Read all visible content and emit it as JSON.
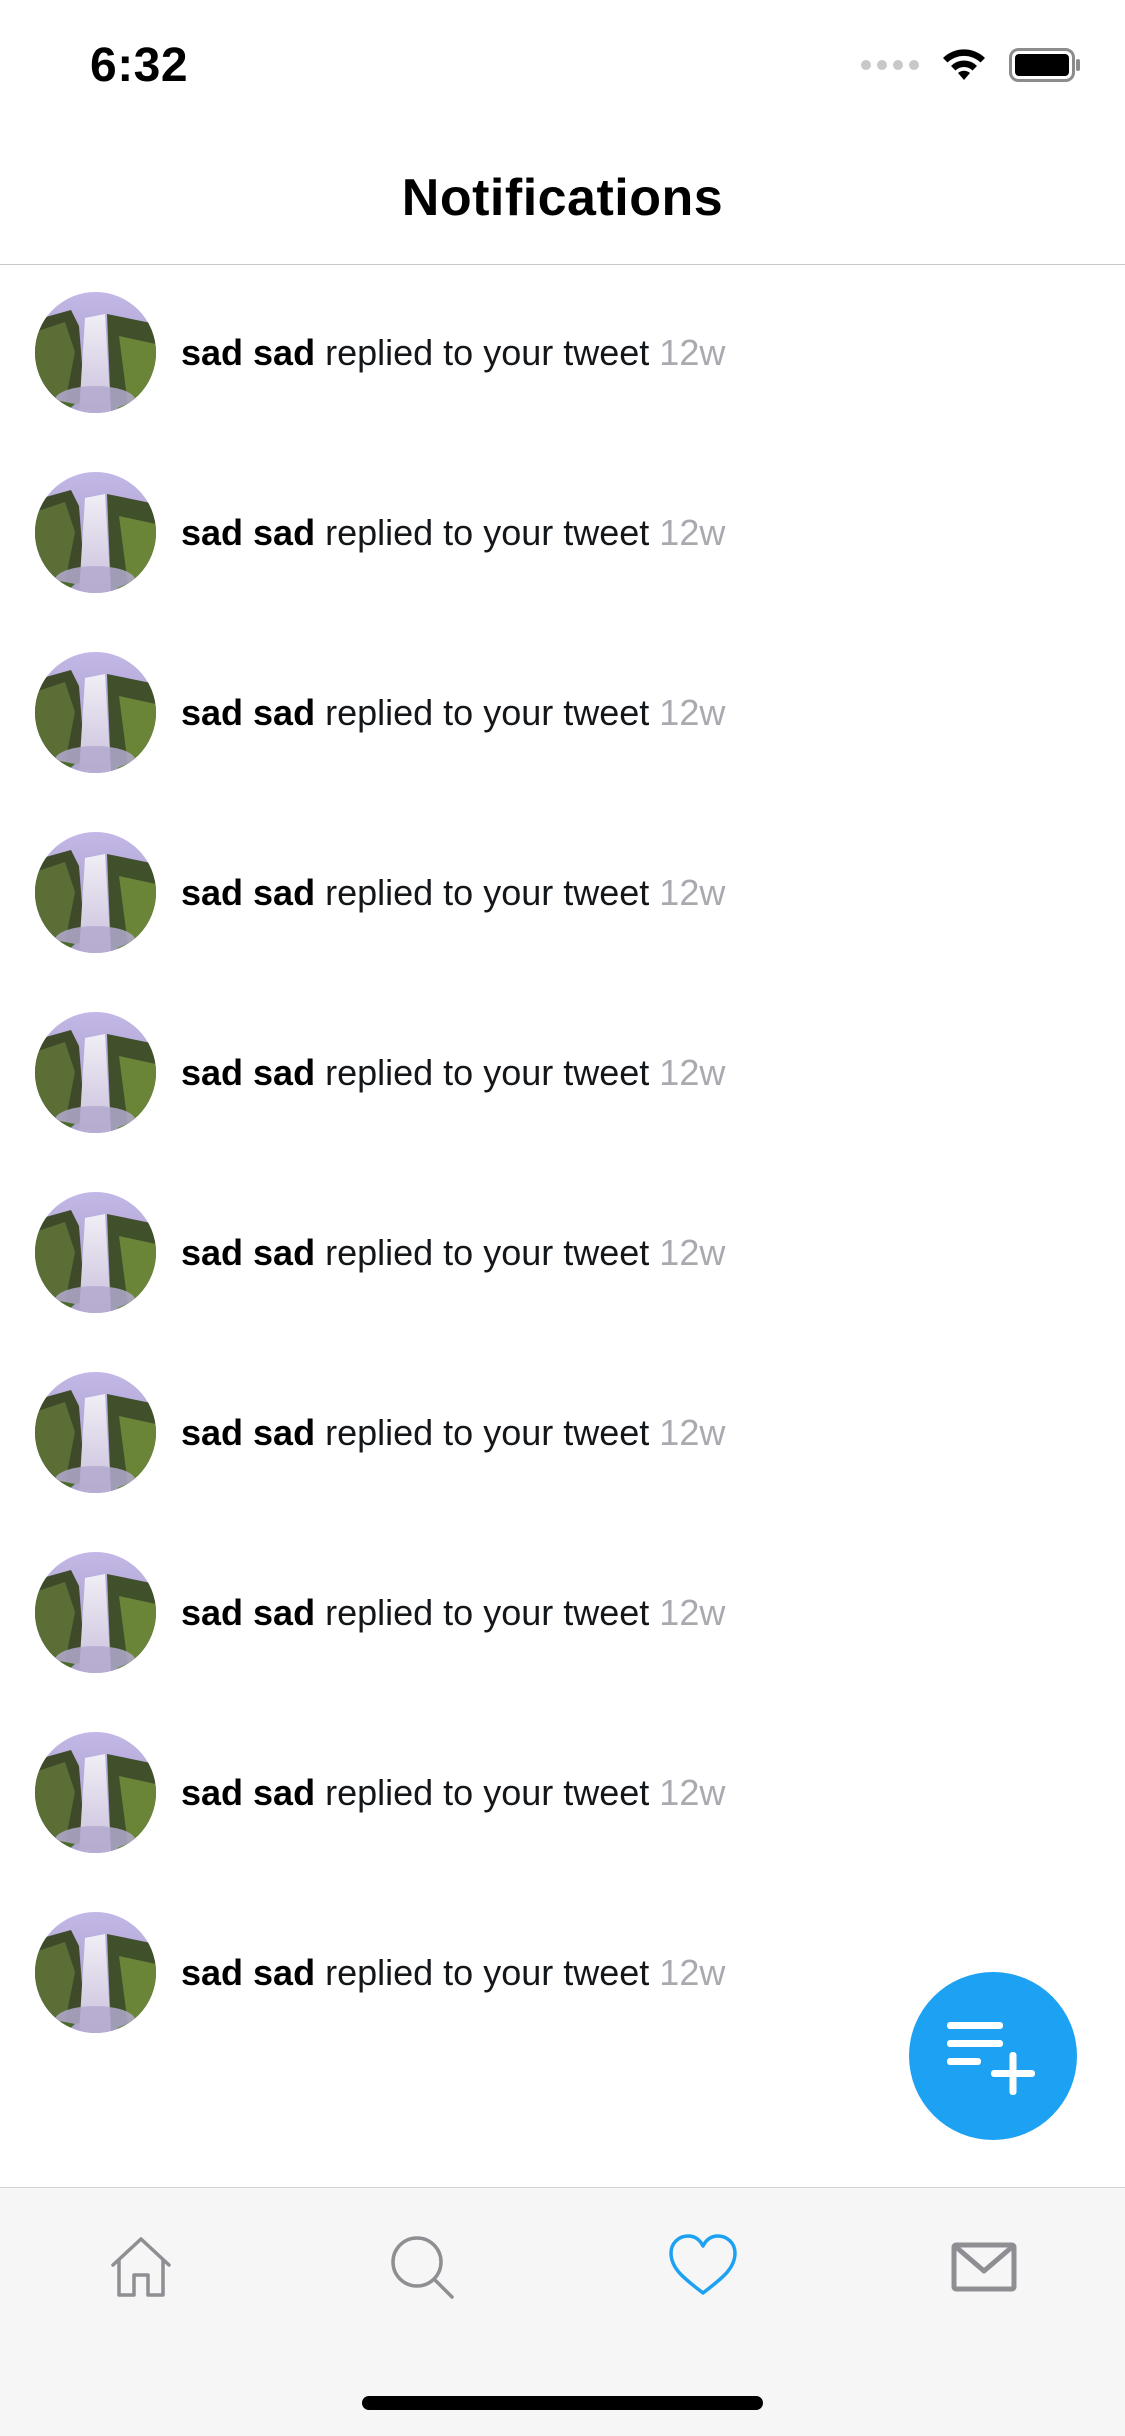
{
  "status_bar": {
    "time": "6:32"
  },
  "header": {
    "title": "Notifications"
  },
  "notifications": [
    {
      "user": "sad sad",
      "action": "replied to your tweet",
      "time": "12w"
    },
    {
      "user": "sad sad",
      "action": "replied to your tweet",
      "time": "12w"
    },
    {
      "user": "sad sad",
      "action": "replied to your tweet",
      "time": "12w"
    },
    {
      "user": "sad sad",
      "action": "replied to your tweet",
      "time": "12w"
    },
    {
      "user": "sad sad",
      "action": "replied to your tweet",
      "time": "12w"
    },
    {
      "user": "sad sad",
      "action": "replied to your tweet",
      "time": "12w"
    },
    {
      "user": "sad sad",
      "action": "replied to your tweet",
      "time": "12w"
    },
    {
      "user": "sad sad",
      "action": "replied to your tweet",
      "time": "12w"
    },
    {
      "user": "sad sad",
      "action": "replied to your tweet",
      "time": "12w"
    },
    {
      "user": "sad sad",
      "action": "replied to your tweet",
      "time": "12w"
    }
  ],
  "fab": {
    "icon": "compose-list-add-icon"
  },
  "tab_bar": {
    "items": [
      {
        "icon": "home-icon",
        "active": false
      },
      {
        "icon": "search-icon",
        "active": false
      },
      {
        "icon": "heart-icon",
        "active": true
      },
      {
        "icon": "mail-icon",
        "active": false
      }
    ]
  },
  "colors": {
    "accent": "#1da1f2",
    "inactive_icon": "#8e8e93",
    "timestamp": "#a9a9b0"
  }
}
